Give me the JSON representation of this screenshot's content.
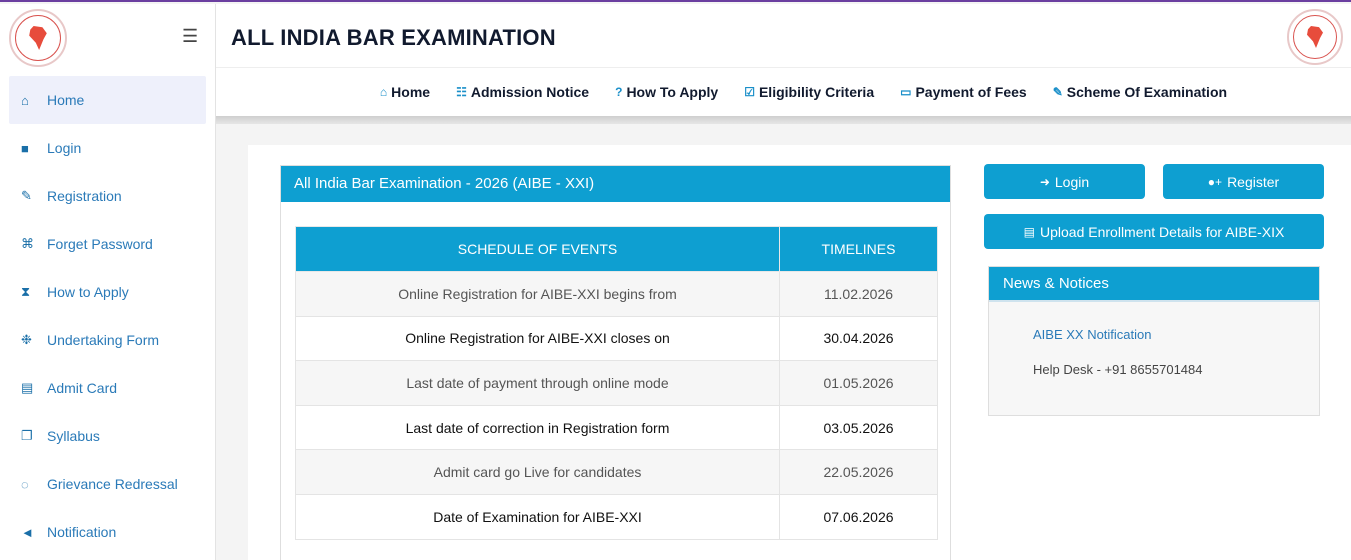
{
  "header": {
    "title": "ALL INDIA BAR EXAMINATION",
    "menu_icon": "hamburger-icon"
  },
  "sidebar": {
    "items": [
      {
        "label": "Home",
        "icon": "home-icon",
        "glyph": "⌂"
      },
      {
        "label": "Login",
        "icon": "lock-icon",
        "glyph": "■"
      },
      {
        "label": "Registration",
        "icon": "edit-icon",
        "glyph": "✎"
      },
      {
        "label": "Forget Password",
        "icon": "key-icon",
        "glyph": "⌘"
      },
      {
        "label": "How to Apply",
        "icon": "hourglass-icon",
        "glyph": "⧗"
      },
      {
        "label": "Undertaking Form",
        "icon": "handshake-icon",
        "glyph": "❉"
      },
      {
        "label": "Admit Card",
        "icon": "id-card-icon",
        "glyph": "▤"
      },
      {
        "label": "Syllabus",
        "icon": "copy-icon",
        "glyph": "❐"
      },
      {
        "label": "Grievance Redressal",
        "icon": "comments-icon",
        "glyph": "◌"
      },
      {
        "label": "Notification",
        "icon": "bullhorn-icon",
        "glyph": "◄"
      }
    ]
  },
  "nav": {
    "links": [
      {
        "label": "Home",
        "icon": "home-icon",
        "glyph": "⌂"
      },
      {
        "label": "Admission Notice",
        "icon": "file-icon",
        "glyph": "☷"
      },
      {
        "label": "How To Apply",
        "icon": "question-icon",
        "glyph": "?"
      },
      {
        "label": "Eligibility Criteria",
        "icon": "check-square-icon",
        "glyph": "☑"
      },
      {
        "label": "Payment of Fees",
        "icon": "credit-card-icon",
        "glyph": "▭"
      },
      {
        "label": "Scheme Of Examination",
        "icon": "edit-icon",
        "glyph": "✎"
      }
    ]
  },
  "schedule": {
    "title": "All India Bar Examination - 2026 (AIBE - XXI)",
    "col_event": "SCHEDULE OF EVENTS",
    "col_time": "TIMELINES",
    "rows": [
      {
        "event": "Online Registration for AIBE-XXI begins from",
        "date": "11.02.2026"
      },
      {
        "event": "Online Registration for AIBE-XXI closes on",
        "date": "30.04.2026"
      },
      {
        "event": "Last date of payment through online mode",
        "date": "01.05.2026"
      },
      {
        "event": "Last date of correction in Registration form",
        "date": "03.05.2026"
      },
      {
        "event": "Admit card go Live for candidates",
        "date": "22.05.2026"
      },
      {
        "event": "Date of Examination for AIBE-XXI",
        "date": "07.06.2026"
      }
    ]
  },
  "actions": {
    "login_label": "Login",
    "register_label": "Register",
    "upload_label": "Upload Enrollment Details for AIBE-XIX"
  },
  "news": {
    "title": "News & Notices",
    "link": "AIBE XX Notification",
    "helpdesk": "Help Desk - +91 8655701484"
  },
  "colors": {
    "accent": "#0e9fd1",
    "link": "#2a7ab8",
    "title": "#111a2e"
  }
}
